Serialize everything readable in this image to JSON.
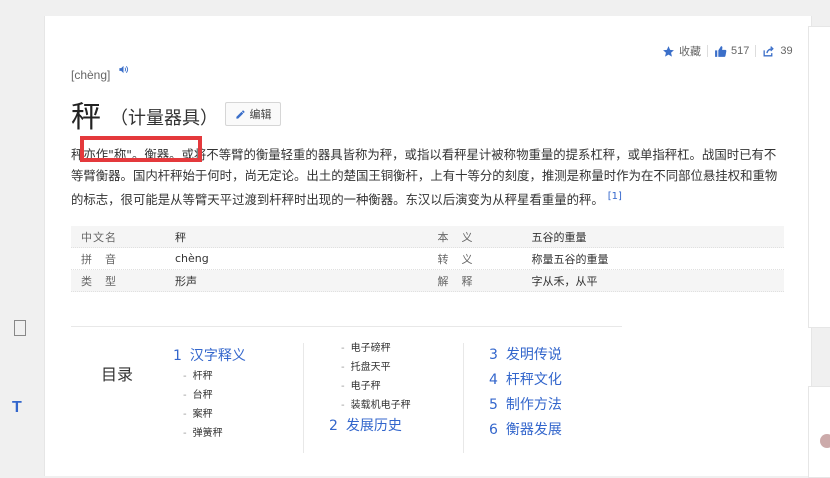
{
  "actions": {
    "favorite_label": "收藏",
    "like_count": "517",
    "share_count": "39"
  },
  "entry": {
    "pinyin": "[chèng]",
    "title": "秤",
    "subtitle": "（计量器具）",
    "edit_label": "编辑"
  },
  "summary": {
    "text": "秤亦作\"称\"。衡器。或将不等臂的衡量轻重的器具皆称为秤，或指以看秤星计被称物重量的提系杠秤，或单指秤杠。战国时已有不等臂衡器。国内杆秤始于何时，尚无定论。出土的楚国王铜衡杆，上有十等分的刻度，推测是称量时作为在不同部位悬挂权和重物的标志，很可能是从等臂天平过渡到杆秤时出现的一种衡器。东汉以后演变为从秤星看重量的秤。",
    "ref": "[1]"
  },
  "infobox": [
    {
      "k1": "中文名",
      "v1": "秤",
      "k2": "本　义",
      "v2": "五谷的重量"
    },
    {
      "k1": "拼　音",
      "v1": "chèng",
      "k2": "转　义",
      "v2": "称量五谷的重量"
    },
    {
      "k1": "类　型",
      "v1": "形声",
      "k2": "解　释",
      "v2": "字从禾，从平"
    }
  ],
  "toc": {
    "label": "目录",
    "col1": {
      "num": "1",
      "title": "汉字释义",
      "subs": [
        "杆秤",
        "台秤",
        "案秤",
        "弹簧秤"
      ]
    },
    "col2": {
      "subs": [
        "电子磅秤",
        "托盘天平",
        "电子秤",
        "装载机电子秤"
      ],
      "num": "2",
      "title": "发展历史"
    },
    "col3": [
      {
        "num": "3",
        "title": "发明传说"
      },
      {
        "num": "4",
        "title": "杆秤文化"
      },
      {
        "num": "5",
        "title": "制作方法"
      },
      {
        "num": "6",
        "title": "衡器发展"
      }
    ]
  },
  "side": {
    "t_label": "T"
  }
}
